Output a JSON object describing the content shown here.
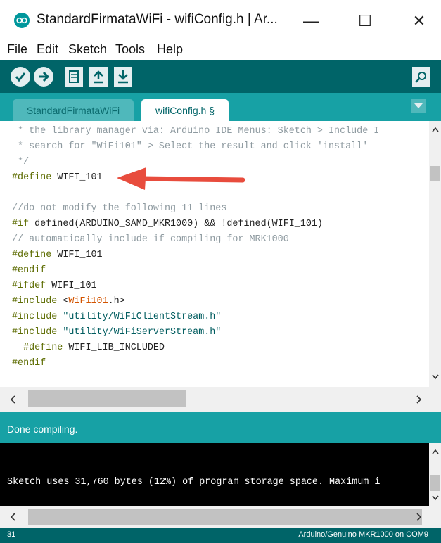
{
  "window": {
    "title": "StandardFirmataWiFi - wifiConfig.h | Ar...",
    "minimize": "—",
    "maximize": "☐",
    "close": "✕"
  },
  "menu": {
    "items": [
      "File",
      "Edit",
      "Sketch",
      "Tools",
      "Help"
    ]
  },
  "toolbar": {
    "buttons": [
      "verify-icon",
      "upload-icon",
      "new-icon",
      "open-icon",
      "save-icon",
      "serial-monitor-icon"
    ]
  },
  "tabs": [
    {
      "label": "StandardFirmataWiFi",
      "active": false
    },
    {
      "label": "wifiConfig.h §",
      "active": true
    }
  ],
  "code": {
    "l1": " * the library manager via: Arduino IDE Menus: Sketch > Include I",
    "l2": " * search for \"WiFi101\" > Select the result and click 'install'",
    "l3": " */",
    "l4_kw": "#define",
    "l4_rest": " WIFI_101",
    "l6": "//do not modify the following 11 lines",
    "l7_kw": "#if",
    "l7_a": " defined(ARDUINO_SAMD_MKR1000) && !defined(WIFI_101)",
    "l8": "// automatically include if compiling for MRK1000",
    "l9_kw": "#define",
    "l9_rest": " WIFI_101",
    "l10_kw": "#endif",
    "l11_kw": "#ifdef",
    "l11_rest": " WIFI_101",
    "l12_kw": "#include",
    "l12_lt": " <",
    "l12_lib": "WiFi101",
    "l12_gt": ".h>",
    "l13_kw": "#include",
    "l13_str": " \"utility/WiFiClientStream.h\"",
    "l14_kw": "#include",
    "l14_str": " \"utility/WiFiServerStream.h\"",
    "l15_kw": "  #define",
    "l15_rest": " WIFI_LIB_INCLUDED",
    "l16_kw": "#endif"
  },
  "annotation": {
    "arrow_color": "#e84c3d"
  },
  "status": {
    "message": "Done compiling."
  },
  "console": {
    "output": "Sketch uses 31,760 bytes (12%) of program storage space. Maximum i"
  },
  "footer": {
    "line_number": "31",
    "board": "Arduino/Genuino MKR1000 on COM9"
  },
  "colors": {
    "toolbar": "#006468",
    "tabbar": "#17a1a5",
    "status": "#17a1a5",
    "console": "#000000"
  }
}
